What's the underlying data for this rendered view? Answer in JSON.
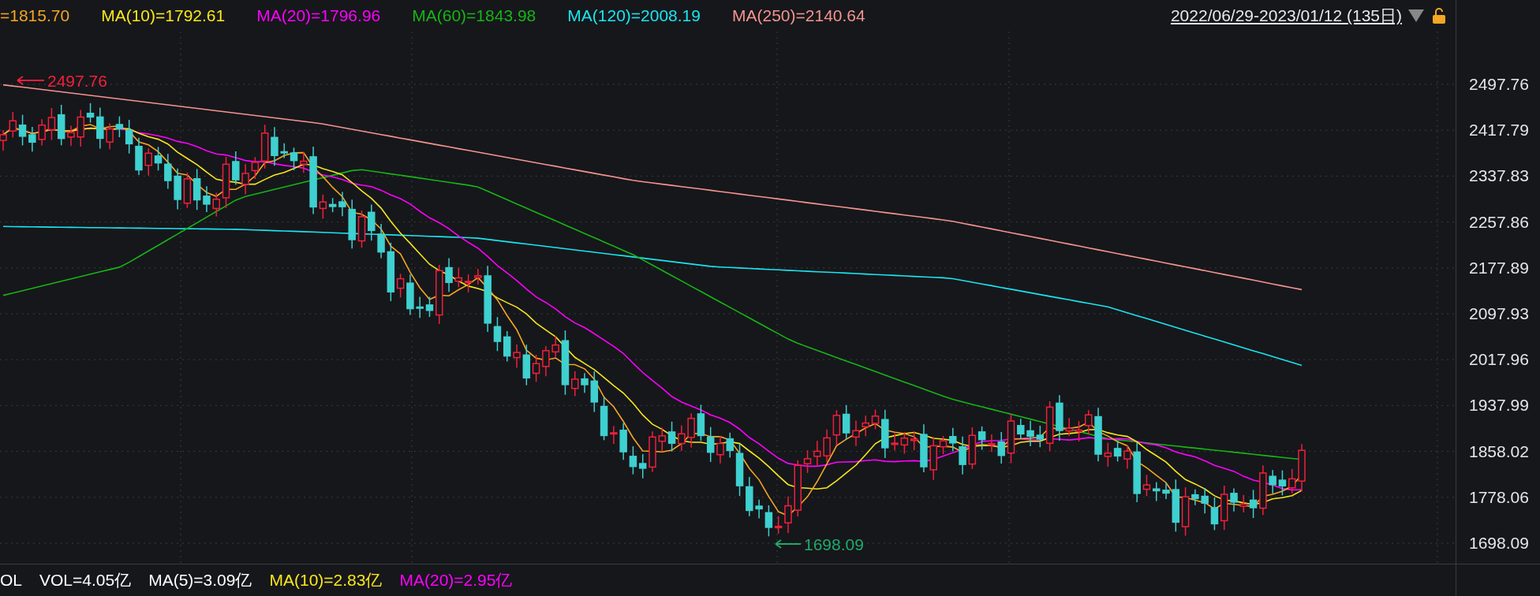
{
  "legend": [
    {
      "label": "=1815.70",
      "color": "#f5a623"
    },
    {
      "label": "MA(10)=1792.61",
      "color": "#f8e71c"
    },
    {
      "label": "MA(20)=1796.96",
      "color": "#ff00ff"
    },
    {
      "label": "MA(60)=1843.98",
      "color": "#16b516"
    },
    {
      "label": "MA(120)=2008.19",
      "color": "#19e6f0"
    },
    {
      "label": "MA(250)=2140.64",
      "color": "#f59490"
    }
  ],
  "date_range": "2022/06/29-2023/01/12 (135日)",
  "y_ticks": [
    "2497.76",
    "2417.79",
    "2337.83",
    "2257.86",
    "2177.89",
    "2097.93",
    "2017.96",
    "1937.99",
    "1858.02",
    "1778.06",
    "1698.09"
  ],
  "high_marker": "2497.76",
  "low_marker": "1698.09",
  "volume_legend": [
    {
      "label": "OL",
      "color": "#ffffff"
    },
    {
      "label": "VOL=4.05亿",
      "color": "#ffffff"
    },
    {
      "label": "MA(5)=3.09亿",
      "color": "#ffffff"
    },
    {
      "label": "MA(10)=2.83亿",
      "color": "#f8e71c"
    },
    {
      "label": "MA(20)=2.95亿",
      "color": "#ff00ff"
    }
  ]
}
